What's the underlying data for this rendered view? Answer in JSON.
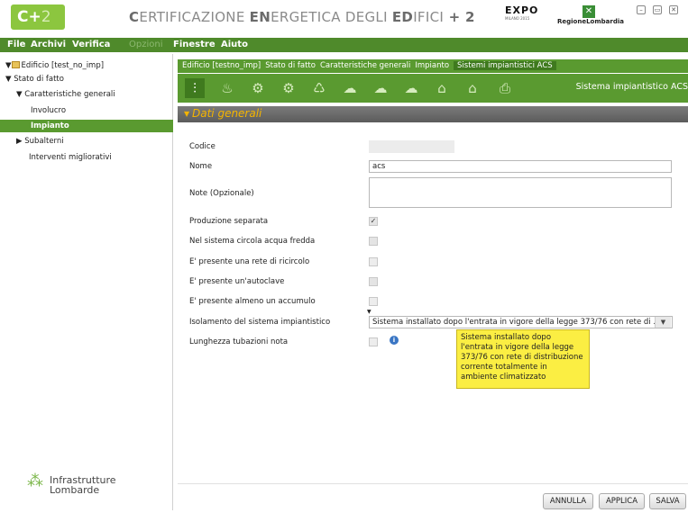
{
  "header": {
    "logo_text": "C+",
    "logo_suffix": "2",
    "title_parts": [
      "C",
      "ERTIFICAZIONE ",
      "EN",
      "ERGETICA DEGLI ",
      "ED",
      "IFICI",
      " + 2"
    ],
    "expo_text": "EXPO",
    "expo_sub": "MILANO 2015",
    "region_text": "RegioneLombardia",
    "window_buttons": [
      "minimize",
      "restore",
      "close"
    ]
  },
  "menu": {
    "file": "File",
    "archivi": "Archivi",
    "verifica": "Verifica",
    "opzioni": "Opzioni",
    "finestre": "Finestre",
    "aiuto": "Aiuto"
  },
  "tree": {
    "root": "Edificio [test_no_imp]",
    "stato_di_fatto": "Stato di fatto",
    "caratteristiche_generali": "Caratteristiche generali",
    "involucro": "Involucro",
    "impianto": "Impianto",
    "subalterni": "Subalterni",
    "interventi": "Interventi migliorativi"
  },
  "footer_logo": {
    "line1": "Infrastrutture",
    "line2": "Lombarde"
  },
  "breadcrumb": {
    "items": [
      "Edificio [testno_imp]",
      "Stato di fatto",
      "Caratteristiche generali",
      "Impianto"
    ],
    "current": "Sistemi impiantistici ACS"
  },
  "toolbar": {
    "section_title": "Sistema impiantistico ACS"
  },
  "panel": {
    "title": "Dati generali"
  },
  "form": {
    "codice_label": "Codice",
    "codice_value": "",
    "nome_label": "Nome",
    "nome_value": "acs",
    "note_label": "Note (Opzionale)",
    "note_value": "",
    "produzione_label": "Produzione separata",
    "acqua_fredda_label": "Nel sistema circola acqua fredda",
    "ricircolo_label": "E' presente una rete di ricircolo",
    "autoclave_label": "E' presente un'autoclave",
    "accumulo_label": "E' presente almeno un accumulo",
    "isolamento_label": "Isolamento del sistema impiantistico",
    "isolamento_value": "Sistema installato dopo l'entrata in vigore della legge 373/76 con rete di ...",
    "lunghezza_label": "Lunghezza tubazioni nota",
    "tooltip": "Sistema installato dopo l'entrata in vigore della legge 373/76 con rete di distribuzione corrente totalmente in ambiente climatizzato",
    "checks": {
      "produzione": true,
      "acqua_fredda": false,
      "ricircolo": false,
      "autoclave": false,
      "accumulo": false,
      "lunghezza": false
    }
  },
  "buttons": {
    "annulla": "ANNULLA",
    "applica": "APPLICA",
    "salva": "SALVA"
  },
  "colors": {
    "brand_green": "#5a9a30",
    "menu_green": "#4f8a2b",
    "accent_yellow": "#f4b400",
    "tooltip_yellow": "#fbee43"
  }
}
